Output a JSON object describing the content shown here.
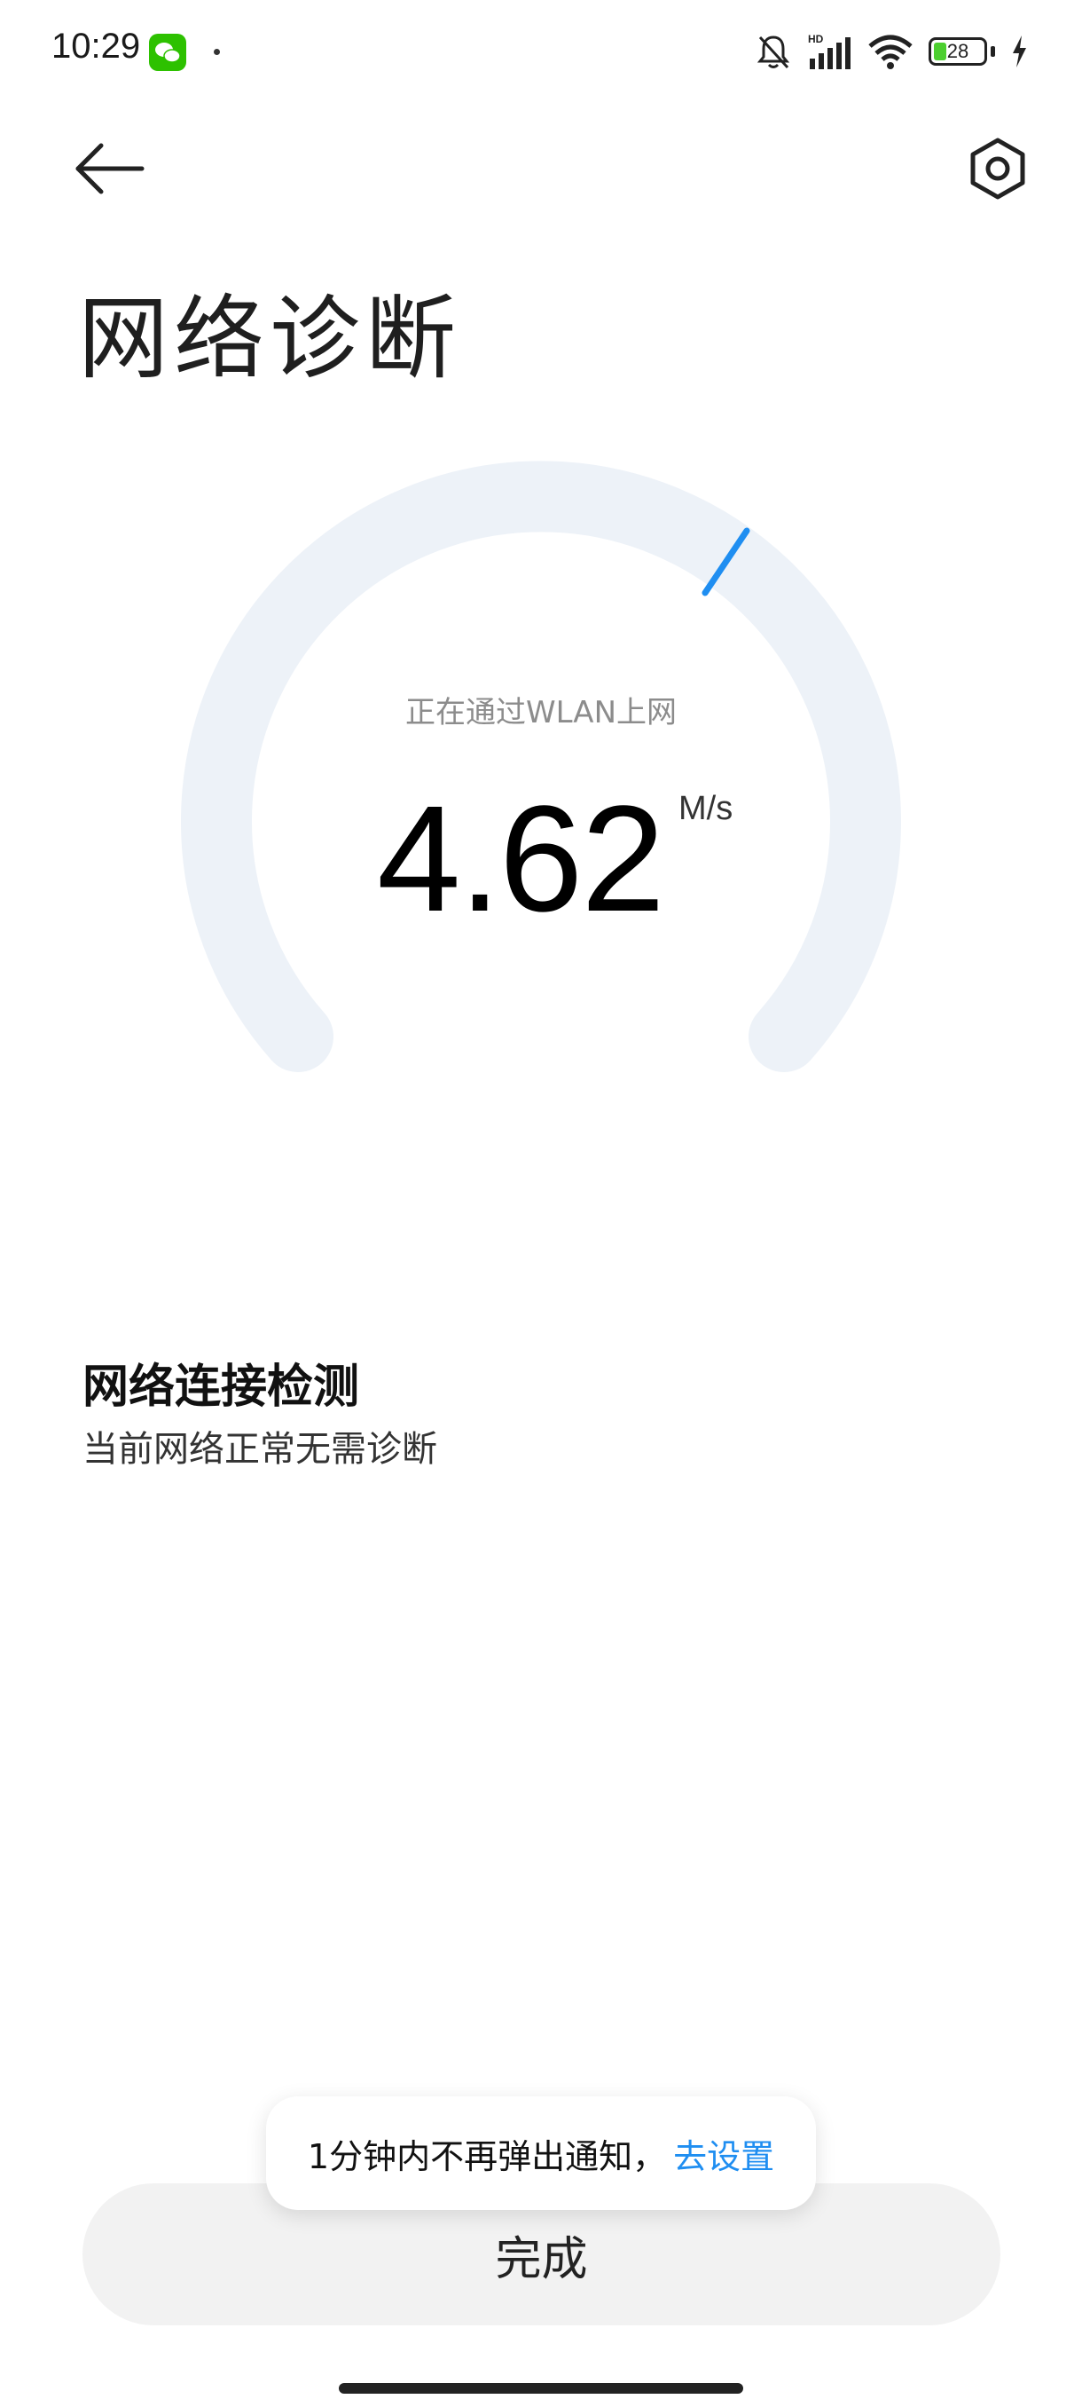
{
  "status_bar": {
    "time": "10:29",
    "battery_level": "28",
    "icons": [
      "wechat-icon",
      "mute-bell-icon",
      "hd-signal-icon",
      "wifi-icon",
      "battery-icon",
      "charging-icon"
    ]
  },
  "header": {
    "title": "网络诊断"
  },
  "gauge": {
    "status_text": "正在通过WLAN上网",
    "speed": "4.62",
    "unit": "M/s",
    "track_color": "#edf2f8",
    "indicator_color": "#1f8ef1"
  },
  "connection_check": {
    "title": "网络连接检测",
    "description": "当前网络正常无需诊断"
  },
  "toast": {
    "message": "1分钟内不再弹出通知，",
    "action": "去设置"
  },
  "footer": {
    "done_label": "完成"
  }
}
